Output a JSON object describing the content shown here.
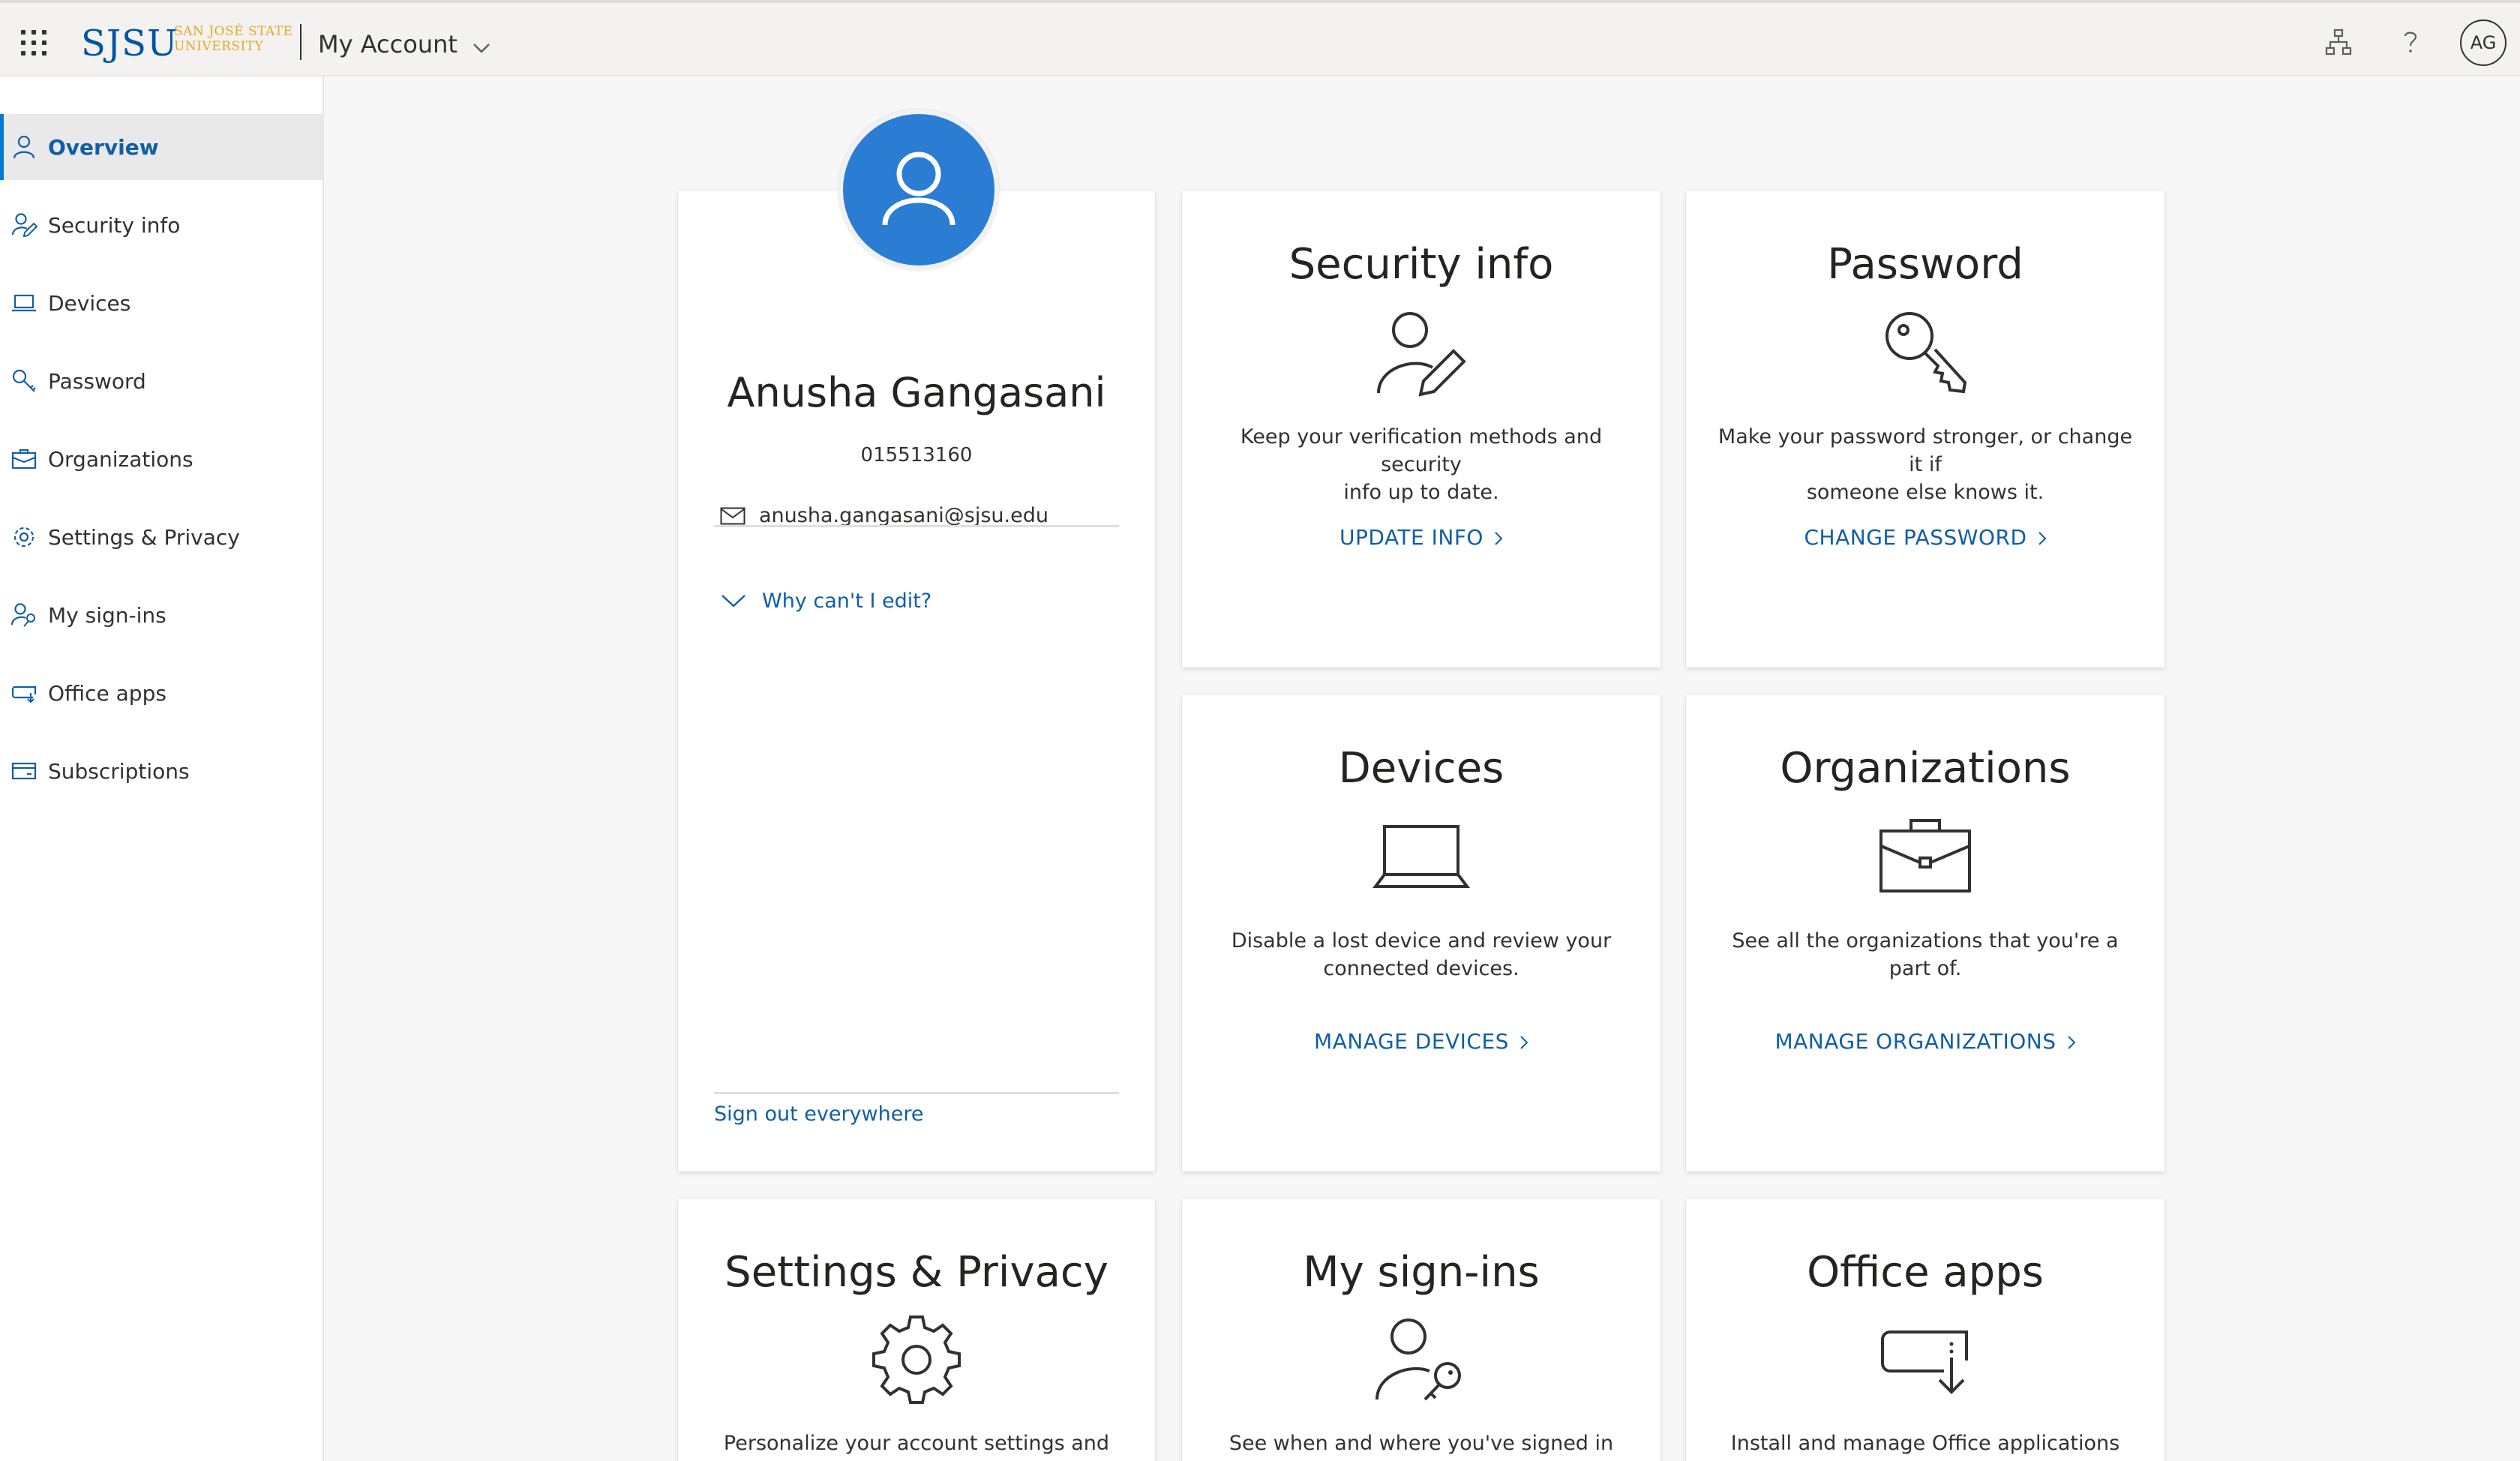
{
  "header": {
    "logo_main": "SJSU",
    "logo_sub_line1": "SAN JOSÉ STATE",
    "logo_sub_line2": "UNIVERSITY",
    "app_title": "My Account",
    "avatar_initials": "AG",
    "icons": [
      "app-launcher-icon",
      "org-chart-icon",
      "help-icon"
    ]
  },
  "sidebar": {
    "items": [
      {
        "label": "Overview",
        "icon": "person-icon",
        "active": true
      },
      {
        "label": "Security info",
        "icon": "person-edit-icon"
      },
      {
        "label": "Devices",
        "icon": "laptop-icon"
      },
      {
        "label": "Password",
        "icon": "key-icon"
      },
      {
        "label": "Organizations",
        "icon": "briefcase-icon"
      },
      {
        "label": "Settings & Privacy",
        "icon": "gear-icon"
      },
      {
        "label": "My sign-ins",
        "icon": "person-key-icon"
      },
      {
        "label": "Office apps",
        "icon": "office-apps-icon"
      },
      {
        "label": "Subscriptions",
        "icon": "card-icon"
      }
    ]
  },
  "profile": {
    "name": "Anusha Gangasani",
    "id": "015513160",
    "email": "anusha.gangasani@sjsu.edu",
    "why_cant_edit": "Why can't I edit?",
    "sign_out": "Sign out everywhere"
  },
  "cards": {
    "security_info": {
      "title": "Security info",
      "desc_line1": "Keep your verification methods and security",
      "desc_line2": "info up to date.",
      "link": "UPDATE INFO"
    },
    "password": {
      "title": "Password",
      "desc_line1": "Make your password stronger, or change it if",
      "desc_line2": "someone else knows it.",
      "link": "CHANGE PASSWORD"
    },
    "devices": {
      "title": "Devices",
      "desc_line1": "Disable a lost device and review your",
      "desc_line2": "connected devices.",
      "link": "MANAGE DEVICES"
    },
    "organizations": {
      "title": "Organizations",
      "desc_line1": "See all the organizations that you're a part of.",
      "link": "MANAGE ORGANIZATIONS"
    },
    "settings_privacy": {
      "title": "Settings & Privacy",
      "desc_line1": "Personalize your account settings and see"
    },
    "my_signins": {
      "title": "My sign-ins",
      "desc_line1": "See when and where you've signed in and"
    },
    "office_apps": {
      "title": "Office apps",
      "desc_line1": "Install and manage Office applications"
    }
  },
  "colors": {
    "accent": "#0078d4",
    "link": "#0f5ea8",
    "avatar_bg": "#2b7cd3",
    "sjsu_blue": "#0055a2",
    "sjsu_gold": "#e5a823"
  }
}
